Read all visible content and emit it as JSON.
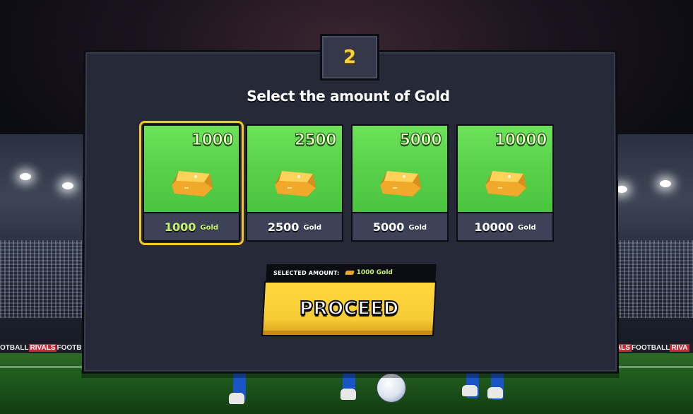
{
  "step": {
    "number": "2"
  },
  "title": "Select the amount of Gold",
  "options": [
    {
      "amount": "1000",
      "label_amount": "1000",
      "label_unit": "Gold",
      "selected": true
    },
    {
      "amount": "2500",
      "label_amount": "2500",
      "label_unit": "Gold",
      "selected": false
    },
    {
      "amount": "5000",
      "label_amount": "5000",
      "label_unit": "Gold",
      "selected": false
    },
    {
      "amount": "10000",
      "label_amount": "10000",
      "label_unit": "Gold",
      "selected": false
    }
  ],
  "selection": {
    "label": "SELECTED AMOUNT:",
    "value": "1000 Gold"
  },
  "proceed": {
    "label": "PROCEED"
  },
  "background": {
    "ad_left": [
      "OTBALL",
      "RIVALS",
      "FOOTB"
    ],
    "ad_right": [
      "RIVALS",
      "FOOTBALL",
      "RIVA"
    ]
  },
  "colors": {
    "accent": "#f3c728",
    "card_green": "#58d04a",
    "panel": "#262937",
    "selected_text": "#c6f36a"
  },
  "icons": [
    "gold-bar-icon"
  ]
}
